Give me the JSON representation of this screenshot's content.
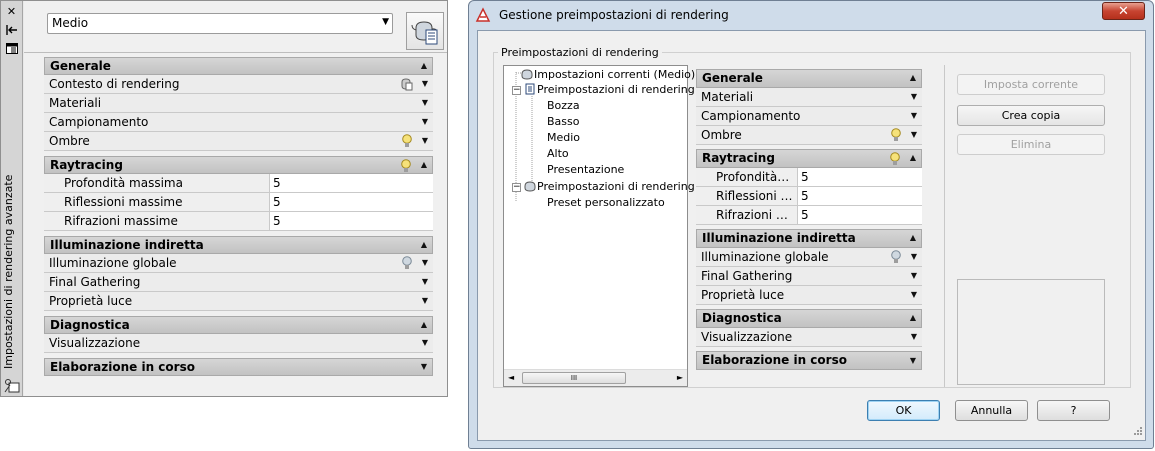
{
  "palette": {
    "title": "Impostazioni di rendering avanzate",
    "preset_value": "Medio",
    "sections": {
      "generale": {
        "label": "Generale",
        "rows": [
          "Contesto di rendering",
          "Materiali",
          "Campionamento",
          "Ombre"
        ]
      },
      "raytracing": {
        "label": "Raytracing",
        "props": [
          {
            "name": "Profondità massima",
            "value": "5"
          },
          {
            "name": "Riflessioni massime",
            "value": "5"
          },
          {
            "name": "Rifrazioni massime",
            "value": "5"
          }
        ]
      },
      "illuminazione": {
        "label": "Illuminazione indiretta",
        "rows": [
          "Illuminazione globale",
          "Final Gathering",
          "Proprietà luce"
        ]
      },
      "diagnostica": {
        "label": "Diagnostica",
        "rows": [
          "Visualizzazione"
        ]
      },
      "elaborazione": {
        "label": "Elaborazione in corso"
      }
    }
  },
  "dialog": {
    "title": "Gestione preimpostazioni di rendering",
    "close_label": "✕",
    "group_label": "Preimpostazioni di rendering",
    "tree": {
      "current": "Impostazioni correnti (Medio)",
      "standard_group": "Preimpostazioni di rendering s",
      "standard_items": [
        "Bozza",
        "Basso",
        "Medio",
        "Alto",
        "Presentazione"
      ],
      "custom_group": "Preimpostazioni di rendering p",
      "custom_items": [
        "Preset personalizzato"
      ],
      "scroll_thumb": "III"
    },
    "sections": {
      "generale": {
        "label": "Generale",
        "rows": [
          "Materiali",
          "Campionamento",
          "Ombre"
        ]
      },
      "raytracing": {
        "label": "Raytracing",
        "props": [
          {
            "name": "Profondità m...",
            "value": "5"
          },
          {
            "name": "Riflessioni m...",
            "value": "5"
          },
          {
            "name": "Rifrazioni ma...",
            "value": "5"
          }
        ]
      },
      "illuminazione": {
        "label": "Illuminazione indiretta",
        "rows": [
          "Illuminazione globale",
          "Final Gathering",
          "Proprietà luce"
        ]
      },
      "diagnostica": {
        "label": "Diagnostica",
        "rows": [
          "Visualizzazione"
        ]
      },
      "elaborazione": {
        "label": "Elaborazione in corso"
      }
    },
    "side_buttons": {
      "set_current": "Imposta corrente",
      "create_copy": "Crea copia",
      "delete": "Elimina"
    },
    "footer": {
      "ok": "OK",
      "cancel": "Annulla",
      "help": "?"
    }
  },
  "colors": {
    "bulb": "#f6e27a",
    "bulb_off": "#cfd8e0",
    "accent": "#3c7fb1",
    "close": "#c74431"
  }
}
